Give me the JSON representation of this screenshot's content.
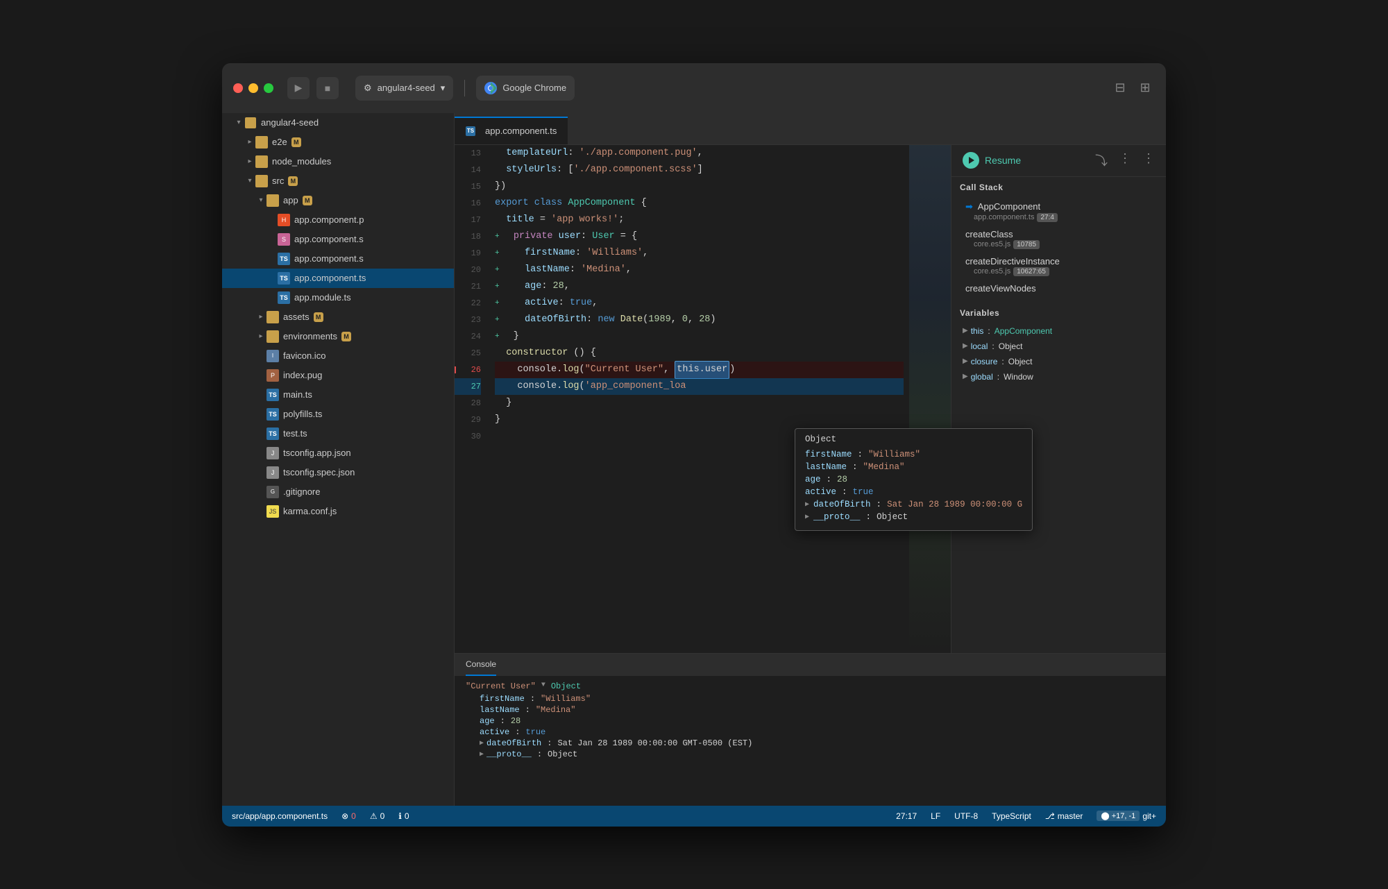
{
  "titlebar": {
    "project_name": "angular4-seed",
    "chrome_label": "Google Chrome",
    "layout_btn1": "⬜",
    "layout_btn2": "⬛"
  },
  "sidebar": {
    "root_label": "angular4-seed",
    "items": [
      {
        "id": "e2e",
        "label": "e2e",
        "type": "folder",
        "indent": 1,
        "has_badge": true,
        "badge": "M",
        "state": "closed"
      },
      {
        "id": "node_modules",
        "label": "node_modules",
        "type": "folder",
        "indent": 1,
        "state": "closed"
      },
      {
        "id": "src",
        "label": "src",
        "type": "folder",
        "indent": 1,
        "has_badge": true,
        "badge": "M",
        "state": "open"
      },
      {
        "id": "app",
        "label": "app",
        "type": "folder",
        "indent": 2,
        "has_badge": true,
        "badge": "M",
        "state": "open"
      },
      {
        "id": "app_component_p",
        "label": "app.component.p",
        "type": "html",
        "indent": 3
      },
      {
        "id": "app_component_s_scss",
        "label": "app.component.s",
        "type": "scss",
        "indent": 3
      },
      {
        "id": "app_component_s_ts",
        "label": "app.component.s",
        "type": "ts",
        "indent": 3
      },
      {
        "id": "app_component_ts",
        "label": "app.component.ts",
        "type": "ts",
        "indent": 3,
        "selected": true
      },
      {
        "id": "app_module_ts",
        "label": "app.module.ts",
        "type": "ts",
        "indent": 3
      },
      {
        "id": "assets",
        "label": "assets",
        "type": "folder",
        "indent": 2,
        "has_badge": true,
        "badge": "M",
        "state": "closed"
      },
      {
        "id": "environments",
        "label": "environments",
        "type": "folder",
        "indent": 2,
        "has_badge": true,
        "badge": "M",
        "state": "closed"
      },
      {
        "id": "favicon_ico",
        "label": "favicon.ico",
        "type": "ico",
        "indent": 2
      },
      {
        "id": "index_pug",
        "label": "index.pug",
        "type": "pug",
        "indent": 2
      },
      {
        "id": "main_ts",
        "label": "main.ts",
        "type": "ts",
        "indent": 2
      },
      {
        "id": "polyfills_ts",
        "label": "polyfills.ts",
        "type": "ts",
        "indent": 2
      },
      {
        "id": "test_ts",
        "label": "test.ts",
        "type": "ts",
        "indent": 2
      },
      {
        "id": "tsconfig_app_json",
        "label": "tsconfig.app.json",
        "type": "json",
        "indent": 2
      },
      {
        "id": "tsconfig_spec_json",
        "label": "tsconfig.spec.json",
        "type": "json",
        "indent": 2
      },
      {
        "id": "gitignore",
        "label": ".gitignore",
        "type": "git",
        "indent": 2
      },
      {
        "id": "karma_conf_js",
        "label": "karma.conf.js",
        "type": "js",
        "indent": 2
      }
    ]
  },
  "editor": {
    "active_tab": "app.component.ts",
    "lines": [
      {
        "num": 13,
        "code": "  templateUrl: './app.component.pug',",
        "added": false
      },
      {
        "num": 14,
        "code": "  styleUrls: ['./app.component.scss']",
        "added": false
      },
      {
        "num": 15,
        "code": "})",
        "added": false
      },
      {
        "num": 16,
        "code": "export class AppComponent {",
        "added": false
      },
      {
        "num": 17,
        "code": "  title = 'app works!';",
        "added": false
      },
      {
        "num": 18,
        "code": "  private user: User = {",
        "added": true
      },
      {
        "num": 19,
        "code": "    firstName: 'Williams',",
        "added": true
      },
      {
        "num": 20,
        "code": "    lastName: 'Medina',",
        "added": true
      },
      {
        "num": 21,
        "code": "    age: 28,",
        "added": true
      },
      {
        "num": 22,
        "code": "    active: true,",
        "added": true
      },
      {
        "num": 23,
        "code": "    dateOfBirth: new Date(1989, 0, 28)",
        "added": true
      },
      {
        "num": 24,
        "code": "  }",
        "added": true
      },
      {
        "num": 25,
        "code": "  constructor () {",
        "added": false
      },
      {
        "num": 26,
        "code": "    console.log(\"Current User\", this.user)",
        "added": false,
        "breakpoint": true
      },
      {
        "num": 27,
        "code": "    console.log('app_component_loa",
        "added": false,
        "active": true
      },
      {
        "num": 28,
        "code": "  }",
        "added": false
      },
      {
        "num": 29,
        "code": "}",
        "added": false
      },
      {
        "num": 30,
        "code": "",
        "added": false
      }
    ]
  },
  "debugger": {
    "resume_label": "Resume",
    "call_stack_title": "Call Stack",
    "stack": [
      {
        "name": "AppComponent",
        "file": "app.component.ts",
        "position": "27:4",
        "active": true
      },
      {
        "name": "createClass",
        "file": "core.es5.js",
        "position": "10785"
      },
      {
        "name": "createDirectiveInstance",
        "file": "core.es5.js",
        "position": "10627:65"
      },
      {
        "name": "createViewNodes",
        "file": "",
        "position": ""
      }
    ],
    "variables_title": "Variables",
    "variables": [
      {
        "key": "this",
        "val": "AppComponent",
        "expandable": true
      },
      {
        "key": "local",
        "val": "Object",
        "expandable": true
      },
      {
        "key": "closure",
        "val": "Object",
        "expandable": true
      },
      {
        "key": "global",
        "val": "Window",
        "expandable": true
      }
    ]
  },
  "tooltip": {
    "title": "Object",
    "props": [
      {
        "key": "firstName",
        "val": "\"Williams\"",
        "type": "str"
      },
      {
        "key": "lastName",
        "val": "\"Medina\"",
        "type": "str"
      },
      {
        "key": "age",
        "val": "28",
        "type": "num"
      },
      {
        "key": "active",
        "val": "true",
        "type": "bool"
      },
      {
        "key": "dateOfBirth",
        "val": "Sat Jan 28 1989 00:00:00 G",
        "type": "str",
        "expandable": true
      },
      {
        "key": "__proto__",
        "val": "Object",
        "type": "obj",
        "expandable": true
      }
    ]
  },
  "console": {
    "tab_label": "Console",
    "lines": [
      {
        "prefix": "\"Current User\"",
        "arrow": "▶",
        "type_label": "Object",
        "props": [
          {
            "key": "firstName",
            "val": "\"Williams\"",
            "type": "str"
          },
          {
            "key": "lastName",
            "val": "\"Medina\"",
            "type": "str"
          },
          {
            "key": "age",
            "val": "28",
            "type": "num"
          },
          {
            "key": "active",
            "val": "true",
            "type": "bool"
          },
          {
            "key": "dateOfBirth",
            "val": "Sat Jan 28 1989 00:00:00 GMT-0500 (EST)",
            "type": "str",
            "expandable": true
          },
          {
            "key": "__proto__",
            "val": "Object",
            "type": "obj",
            "expandable": true
          }
        ]
      }
    ]
  },
  "statusbar": {
    "file_path": "src/app/app.component.ts",
    "errors": "0",
    "warnings": "0",
    "info": "0",
    "cursor": "27:17",
    "line_endings": "LF",
    "encoding": "UTF-8",
    "language": "TypeScript",
    "git_branch": "master",
    "git_changes": "+17, -1",
    "git_label": "git+"
  }
}
